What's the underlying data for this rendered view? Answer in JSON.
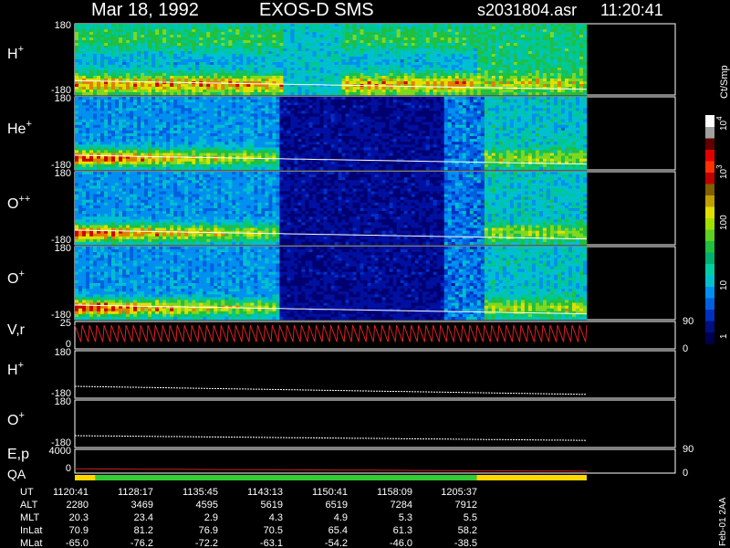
{
  "header": {
    "date": "Mar 18, 1992",
    "mission": "EXOS-D SMS",
    "file": "s2031804.asr",
    "time": "11:20:41"
  },
  "colorbar": {
    "unit": "Ct/Smp",
    "tick_labels": [
      "1",
      "10",
      "100",
      "10",
      "10"
    ],
    "tick_exponents": [
      "",
      "",
      "",
      "3",
      "4"
    ],
    "colors": [
      "#000050",
      "#001080",
      "#0030c0",
      "#0060e0",
      "#0090f0",
      "#00c0d0",
      "#00d0a0",
      "#00b070",
      "#20c040",
      "#60d020",
      "#a0e000",
      "#e0e000",
      "#c0a000",
      "#806000",
      "#c00000",
      "#ff3000",
      "#e00000",
      "#600000",
      "#a0a0a0",
      "#ffffff"
    ]
  },
  "footer": {
    "row_labels": [
      "UT",
      "ALT",
      "MLT",
      "InLat",
      "MLat"
    ],
    "columns": [
      [
        "1120:41",
        "2280",
        "20.3",
        "70.9",
        "-65.0"
      ],
      [
        "1128:17",
        "3469",
        "23.4",
        "81.2",
        "-76.2"
      ],
      [
        "1135:45",
        "4595",
        "2.9",
        "76.9",
        "-72.2"
      ],
      [
        "1143:13",
        "5619",
        "4.3",
        "70.5",
        "-63.1"
      ],
      [
        "1150:41",
        "6519",
        "4.9",
        "65.4",
        "-54.2"
      ],
      [
        "1158:09",
        "7284",
        "5.3",
        "61.3",
        "-46.0"
      ],
      [
        "1205:37",
        "7912",
        "5.5",
        "58.2",
        "-38.5"
      ]
    ],
    "version": "Feb-01 2AA"
  },
  "chart_data": {
    "type": "heatmap",
    "title": "Mar 18, 1992   EXOS-D SMS",
    "panels": [
      {
        "label": "H",
        "superscript": "+",
        "kind": "spectrogram",
        "ylim": [
          -180,
          180
        ],
        "tick_top": "180",
        "tick_bottom": "-180"
      },
      {
        "label": "He",
        "superscript": "+",
        "kind": "spectrogram",
        "ylim": [
          -180,
          180
        ],
        "tick_top": "180",
        "tick_bottom": "-180"
      },
      {
        "label": "O",
        "superscript": "++",
        "kind": "spectrogram",
        "ylim": [
          -180,
          180
        ],
        "tick_top": "180",
        "tick_bottom": "-180"
      },
      {
        "label": "O",
        "superscript": "+",
        "kind": "spectrogram",
        "ylim": [
          -180,
          180
        ],
        "tick_top": "180",
        "tick_bottom": "-180"
      },
      {
        "label": "V,r",
        "superscript": "",
        "kind": "line",
        "ylim": [
          0,
          25
        ],
        "tick_top": "25",
        "tick_bottom": "0",
        "right_ticks": [
          "90",
          "0"
        ]
      },
      {
        "label": "H",
        "superscript": "+",
        "kind": "line",
        "ylim": [
          -180,
          180
        ],
        "tick_top": "180",
        "tick_bottom": "-180"
      },
      {
        "label": "O",
        "superscript": "+",
        "kind": "line",
        "ylim": [
          -180,
          180
        ],
        "tick_top": "180",
        "tick_bottom": "-180"
      },
      {
        "label": "E,p",
        "superscript": "",
        "kind": "line",
        "ylim": [
          0,
          4000
        ],
        "tick_top": "4000",
        "tick_bottom": "0",
        "right_ticks": [
          "90",
          "0"
        ]
      }
    ],
    "qa": {
      "label": "QA",
      "segments": [
        {
          "to": 0.04,
          "color": "#ffd700"
        },
        {
          "to": 0.785,
          "color": "#33cc33"
        },
        {
          "to": 1.0,
          "color": "#ffd700"
        }
      ]
    },
    "x_ticks": [
      "1120:41",
      "1128:17",
      "1135:45",
      "1143:13",
      "1150:41",
      "1158:09",
      "1205:37"
    ]
  }
}
